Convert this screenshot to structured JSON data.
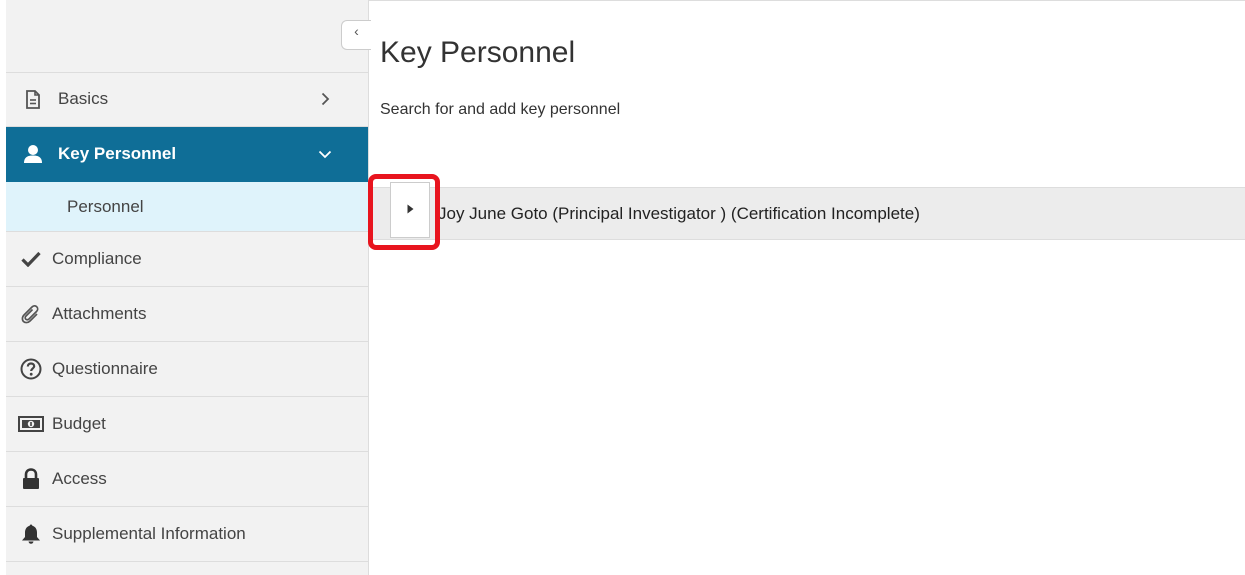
{
  "sidebar": {
    "collapse_glyph": "‹",
    "items": [
      {
        "label": "Basics",
        "icon": "document-icon",
        "expanded": false
      },
      {
        "label": "Key Personnel",
        "icon": "person-icon",
        "expanded": true,
        "active": true
      },
      {
        "label": "Compliance",
        "icon": "checkmark-icon"
      },
      {
        "label": "Attachments",
        "icon": "paperclip-icon"
      },
      {
        "label": "Questionnaire",
        "icon": "question-circle-icon"
      },
      {
        "label": "Budget",
        "icon": "money-icon"
      },
      {
        "label": "Access",
        "icon": "lock-icon"
      },
      {
        "label": "Supplemental Information",
        "icon": "bell-icon"
      }
    ],
    "subitems": [
      {
        "label": "Personnel"
      }
    ]
  },
  "main": {
    "title": "Key Personnel",
    "subtitle": "Search for and add key personnel",
    "personnel": [
      {
        "name": "Joy June Goto (Principal Investigator ) (Certification Incomplete)"
      }
    ]
  },
  "colors": {
    "active_nav_bg": "#0f6e97",
    "sub_nav_bg": "#dff3fb",
    "highlight": "#e8141e",
    "row_bg": "#ececec"
  }
}
